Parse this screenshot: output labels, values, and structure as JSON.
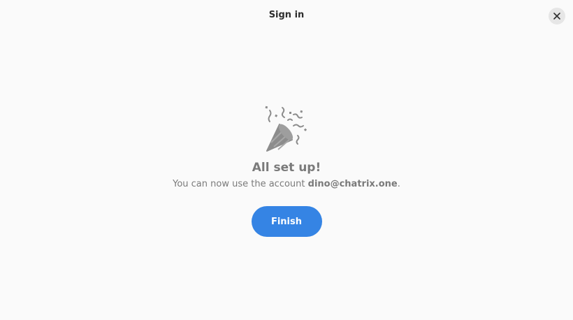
{
  "window": {
    "title": "Sign in"
  },
  "icons": {
    "close": "close-icon",
    "celebration": "party-popper-icon"
  },
  "main": {
    "headline": "All set up!",
    "message_prefix": "You can now use the account ",
    "account": "dino@chatrix.one",
    "message_suffix": ".",
    "finish_label": "Finish"
  },
  "colors": {
    "accent": "#3584e4",
    "background": "#fafafa",
    "muted_text": "#7a7a7a"
  }
}
